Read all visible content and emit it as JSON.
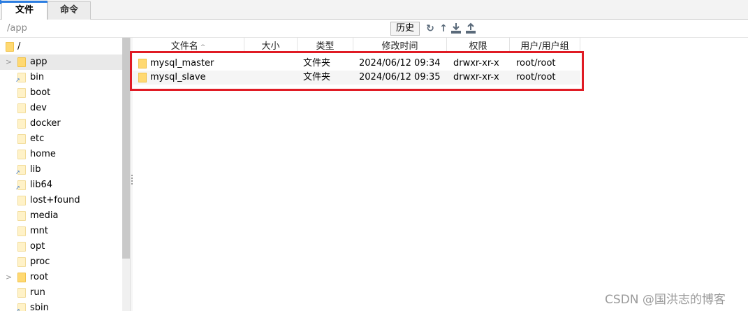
{
  "tabs": [
    {
      "label": "文件",
      "active": true
    },
    {
      "label": "命令",
      "active": false
    }
  ],
  "path_bar": {
    "value": "/app",
    "history_label": "历史",
    "icons": [
      "refresh-icon",
      "up-icon",
      "download-icon",
      "upload-icon"
    ]
  },
  "tree": {
    "root_label": "/",
    "items": [
      {
        "label": "app",
        "expandable": true,
        "selected": true,
        "symlink": false
      },
      {
        "label": "bin",
        "expandable": false,
        "selected": false,
        "symlink": true
      },
      {
        "label": "boot",
        "expandable": false,
        "selected": false,
        "symlink": false
      },
      {
        "label": "dev",
        "expandable": false,
        "selected": false,
        "symlink": false
      },
      {
        "label": "docker",
        "expandable": false,
        "selected": false,
        "symlink": false
      },
      {
        "label": "etc",
        "expandable": false,
        "selected": false,
        "symlink": false
      },
      {
        "label": "home",
        "expandable": false,
        "selected": false,
        "symlink": false
      },
      {
        "label": "lib",
        "expandable": false,
        "selected": false,
        "symlink": true
      },
      {
        "label": "lib64",
        "expandable": false,
        "selected": false,
        "symlink": true
      },
      {
        "label": "lost+found",
        "expandable": false,
        "selected": false,
        "symlink": false
      },
      {
        "label": "media",
        "expandable": false,
        "selected": false,
        "symlink": false
      },
      {
        "label": "mnt",
        "expandable": false,
        "selected": false,
        "symlink": false
      },
      {
        "label": "opt",
        "expandable": false,
        "selected": false,
        "symlink": false
      },
      {
        "label": "proc",
        "expandable": false,
        "selected": false,
        "symlink": false
      },
      {
        "label": "root",
        "expandable": true,
        "selected": false,
        "symlink": false
      },
      {
        "label": "run",
        "expandable": false,
        "selected": false,
        "symlink": false
      },
      {
        "label": "sbin",
        "expandable": false,
        "selected": false,
        "symlink": true
      }
    ]
  },
  "file_list": {
    "columns": [
      "文件名",
      "大小",
      "类型",
      "修改时间",
      "权限",
      "用户/用户组"
    ],
    "sort_column": "文件名",
    "sort_arrow": "^",
    "rows": [
      {
        "name": "mysql_master",
        "size": "",
        "type": "文件夹",
        "modified": "2024/06/12 09:34",
        "permissions": "drwxr-xr-x",
        "owner": "root/root"
      },
      {
        "name": "mysql_slave",
        "size": "",
        "type": "文件夹",
        "modified": "2024/06/12 09:35",
        "permissions": "drwxr-xr-x",
        "owner": "root/root"
      }
    ]
  },
  "colors": {
    "highlight": "#e01b24",
    "folder": "#ffd972",
    "tab_accent": "#2b7de1"
  },
  "watermark": "CSDN @国洪志的博客"
}
